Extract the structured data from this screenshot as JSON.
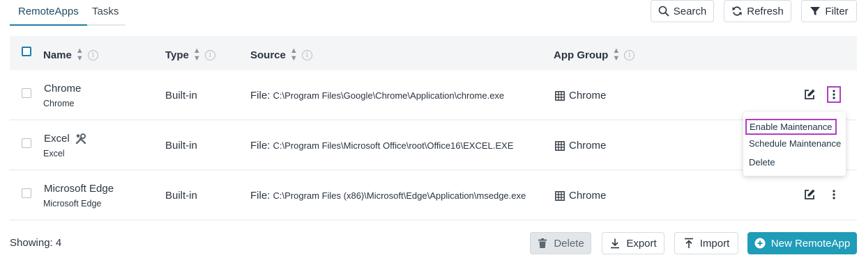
{
  "tabs": [
    {
      "label": "RemoteApps",
      "active": true
    },
    {
      "label": "Tasks",
      "active": false
    }
  ],
  "toolbar": {
    "search_label": "Search",
    "refresh_label": "Refresh",
    "filter_label": "Filter"
  },
  "table": {
    "headers": {
      "name": "Name",
      "type": "Type",
      "source": "Source",
      "app_group": "App Group"
    },
    "rows": [
      {
        "name": "Chrome",
        "subname": "Chrome",
        "type": "Built-in",
        "source_prefix": "File:",
        "source_path": "C:\\Program Files\\Google\\Chrome\\Application\\chrome.exe",
        "app_group": "Chrome",
        "maintenance": false
      },
      {
        "name": "Excel",
        "subname": "Excel",
        "type": "Built-in",
        "source_prefix": "File:",
        "source_path": "C:\\Program Files\\Microsoft Office\\root\\Office16\\EXCEL.EXE",
        "app_group": "Chrome",
        "maintenance": true
      },
      {
        "name": "Microsoft Edge",
        "subname": "Microsoft Edge",
        "type": "Built-in",
        "source_prefix": "File:",
        "source_path": "C:\\Program Files (x86)\\Microsoft\\Edge\\Application\\msedge.exe",
        "app_group": "Chrome",
        "maintenance": false
      }
    ]
  },
  "context_menu": {
    "items": [
      "Enable Maintenance",
      "Schedule Maintenance",
      "Delete"
    ],
    "highlighted": "Enable Maintenance"
  },
  "footer": {
    "showing": "Showing: 4",
    "delete_label": "Delete",
    "export_label": "Export",
    "import_label": "Import",
    "new_label": "New RemoteApp"
  },
  "colors": {
    "accent": "#1f9cb8",
    "highlight": "#b23cc4",
    "header_bg": "#f3f5f7"
  }
}
